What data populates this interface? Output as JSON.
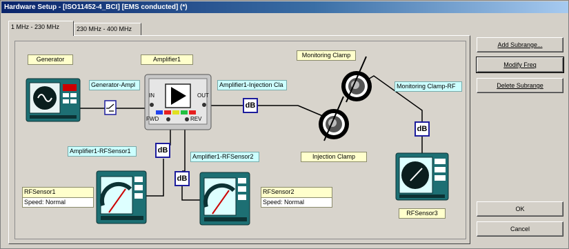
{
  "window": {
    "title": "Hardware Setup - [ISO11452-4_BCI] [EMS conducted] (*)"
  },
  "tabs": [
    {
      "label": "1 MHz - 230 MHz",
      "active": true
    },
    {
      "label": "230 MHz - 400 MHz",
      "active": false
    }
  ],
  "devices": {
    "generator": {
      "label": "Generator"
    },
    "amplifier": {
      "label": "Amplifier1",
      "port_in": "IN",
      "port_out": "OUT",
      "port_fwd": "FWD",
      "port_rev": "REV"
    },
    "monitoring_clamp": {
      "label": "Monitoring Clamp"
    },
    "injection_clamp": {
      "label": "Injection Clamp"
    },
    "rfsensor1": {
      "name": "RFSensor1",
      "speed": "Speed: Normal"
    },
    "rfsensor2": {
      "name": "RFSensor2",
      "speed": "Speed: Normal"
    },
    "rfsensor3": {
      "label": "RFSensor3"
    }
  },
  "cables": {
    "gen_amp": "Generator-Ampl",
    "amp_inj": "Amplifier1-Injection Cla",
    "mon_rf": "Monitoring Clamp-RF",
    "amp_rf1": "Amplifier1-RFSensor1",
    "amp_rf2": "Amplifier1-RFSensor2"
  },
  "attenuator_label": "dB",
  "buttons": {
    "add_subrange": "Add Subrange...",
    "modify_freq": "Modify Freq",
    "delete_subrange": "Delete Subrange",
    "ok": "OK",
    "cancel": "Cancel"
  },
  "colors": {
    "title_start": "#0a246a",
    "label_yellow": "#ffffcc",
    "cable_cyan": "#ccffff",
    "attenuator_border": "#1c1c9c",
    "instrument_teal": "#2a8c8c"
  }
}
